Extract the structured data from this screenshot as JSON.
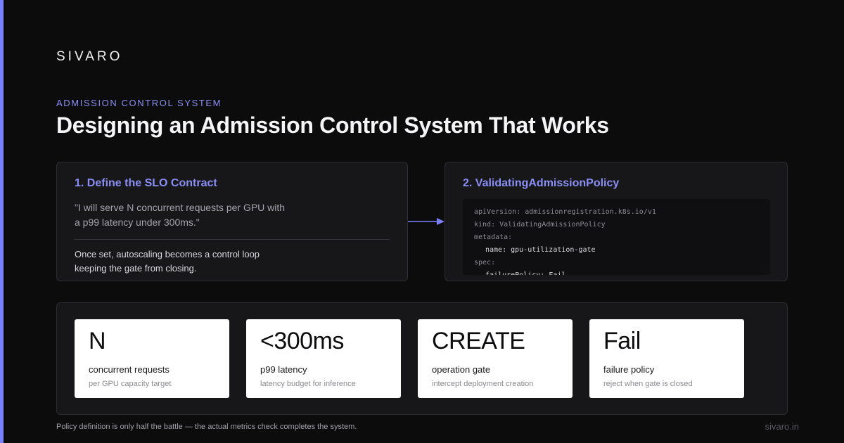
{
  "brand": "SIVARO",
  "eyebrow": "ADMISSION CONTROL SYSTEM",
  "title": "Designing an Admission Control System That Works",
  "colors": {
    "accent": "#7b80ff",
    "heading": "#8a8ef5",
    "background": "#0c0c0d",
    "card": "#17171a"
  },
  "left_card": {
    "heading": "1. Define the SLO Contract",
    "quote": "\"I will serve N concurrent requests per GPU with a p99 latency under 300ms.\"",
    "note": "Once set, autoscaling becomes a control loop keeping the gate from closing."
  },
  "connector": {
    "icon": "arrow-right-icon"
  },
  "right_card": {
    "heading": "2. ValidatingAdmissionPolicy",
    "code": [
      "apiVersion: admissionregistration.k8s.io/v1",
      "kind: ValidatingAdmissionPolicy",
      "metadata:",
      "name: gpu-utilization-gate",
      "spec:",
      "failurePolicy: Fail"
    ]
  },
  "metrics": [
    {
      "value": "N",
      "label": "concurrent requests",
      "sub": "per GPU capacity target"
    },
    {
      "value": "<300ms",
      "label": "p99 latency",
      "sub": "latency budget for inference"
    },
    {
      "value": "CREATE",
      "label": "operation gate",
      "sub": "intercept deployment creation"
    },
    {
      "value": "Fail",
      "label": "failure policy",
      "sub": "reject when gate is closed"
    }
  ],
  "footer": "Policy definition is only half the battle — the actual metrics check completes the system.",
  "site": "sivaro.in"
}
